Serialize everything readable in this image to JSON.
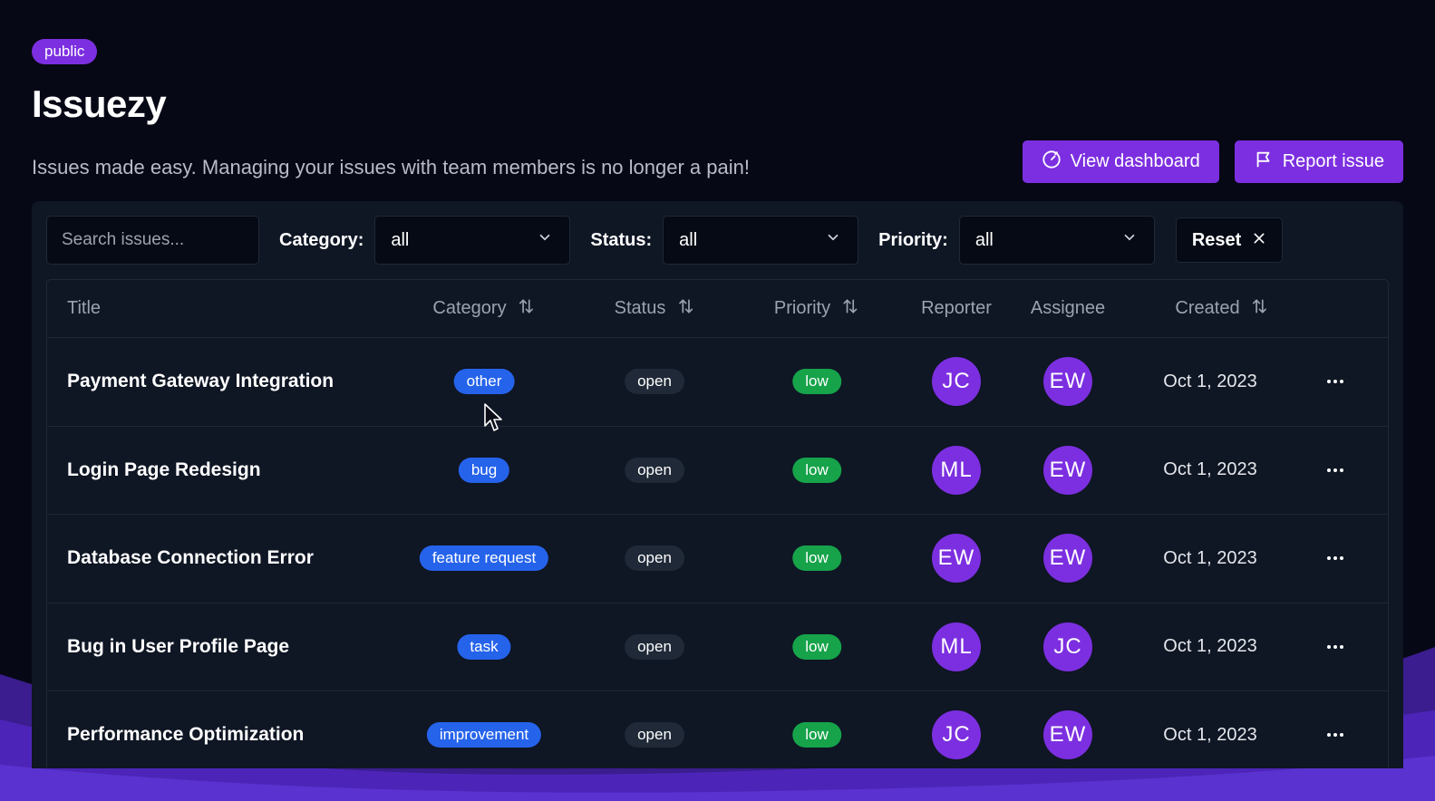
{
  "badge": "public",
  "app": {
    "title": "Issuezy",
    "subtitle": "Issues made easy. Managing your issues with team members is no longer a pain!"
  },
  "actions": {
    "dashboard_label": "View dashboard",
    "report_label": "Report issue"
  },
  "filters": {
    "search_placeholder": "Search issues...",
    "category_label": "Category:",
    "category_value": "all",
    "status_label": "Status:",
    "status_value": "all",
    "priority_label": "Priority:",
    "priority_value": "all",
    "reset_label": "Reset"
  },
  "columns": {
    "title": "Title",
    "category": "Category",
    "status": "Status",
    "priority": "Priority",
    "reporter": "Reporter",
    "assignee": "Assignee",
    "created": "Created"
  },
  "issues": [
    {
      "title": "Payment Gateway Integration",
      "category": "other",
      "status": "open",
      "priority": "low",
      "reporter": "JC",
      "assignee": "EW",
      "created": "Oct 1, 2023"
    },
    {
      "title": "Login Page Redesign",
      "category": "bug",
      "status": "open",
      "priority": "low",
      "reporter": "ML",
      "assignee": "EW",
      "created": "Oct 1, 2023"
    },
    {
      "title": "Database Connection Error",
      "category": "feature request",
      "status": "open",
      "priority": "low",
      "reporter": "EW",
      "assignee": "EW",
      "created": "Oct 1, 2023"
    },
    {
      "title": "Bug in User Profile Page",
      "category": "task",
      "status": "open",
      "priority": "low",
      "reporter": "ML",
      "assignee": "JC",
      "created": "Oct 1, 2023"
    },
    {
      "title": "Performance Optimization",
      "category": "improvement",
      "status": "open",
      "priority": "low",
      "reporter": "JC",
      "assignee": "EW",
      "created": "Oct 1, 2023"
    }
  ],
  "colors": {
    "accent": "#7c2fe0",
    "category_pill": "#2563eb",
    "priority_low": "#16a34a",
    "background": "#060815",
    "panel": "#0f1624"
  },
  "icons": {
    "dashboard": "gauge-icon",
    "report": "flag-icon",
    "dropdown": "chevron-down-icon",
    "reset": "close-icon",
    "sort": "sort-arrows-icon",
    "row_menu": "more-horizontal-icon"
  }
}
